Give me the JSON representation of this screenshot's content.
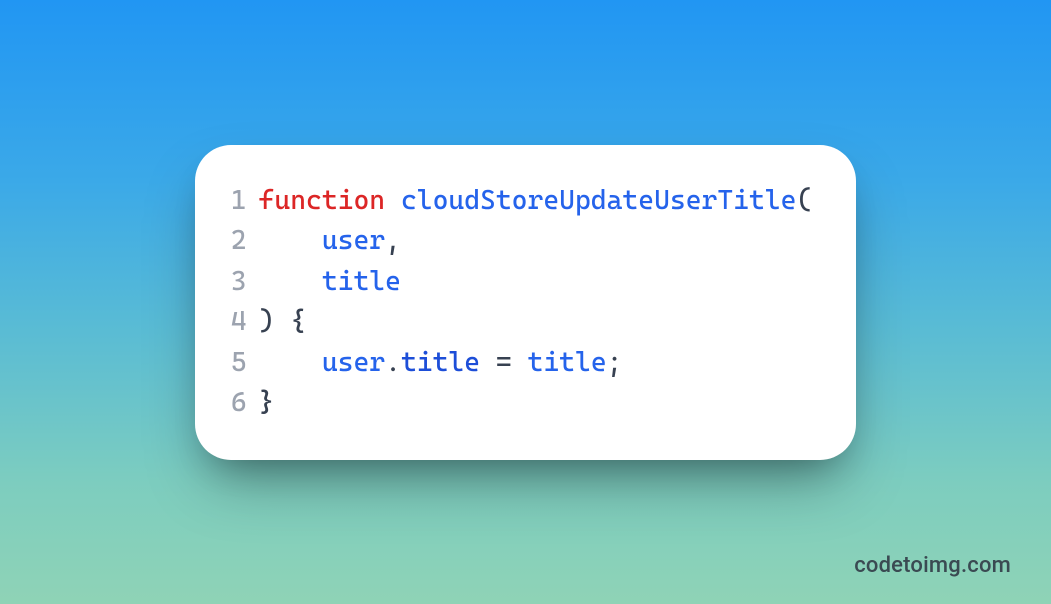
{
  "branding": "codetoimg.com",
  "code": {
    "language": "javascript",
    "lines": [
      {
        "number": "1",
        "tokens": [
          {
            "cls": "tok-keyword",
            "text": "function"
          },
          {
            "cls": "tok-plain",
            "text": " "
          },
          {
            "cls": "tok-func",
            "text": "cloudStoreUpdateUserTitle"
          },
          {
            "cls": "tok-punct",
            "text": "("
          }
        ]
      },
      {
        "number": "2",
        "tokens": [
          {
            "cls": "tok-plain",
            "text": "    "
          },
          {
            "cls": "tok-ident",
            "text": "user"
          },
          {
            "cls": "tok-punct",
            "text": ","
          }
        ]
      },
      {
        "number": "3",
        "tokens": [
          {
            "cls": "tok-plain",
            "text": "    "
          },
          {
            "cls": "tok-ident",
            "text": "title"
          }
        ]
      },
      {
        "number": "4",
        "tokens": [
          {
            "cls": "tok-punct",
            "text": ")"
          },
          {
            "cls": "tok-plain",
            "text": " "
          },
          {
            "cls": "tok-punct",
            "text": "{"
          }
        ]
      },
      {
        "number": "5",
        "tokens": [
          {
            "cls": "tok-plain",
            "text": "    "
          },
          {
            "cls": "tok-ident",
            "text": "user"
          },
          {
            "cls": "tok-punct",
            "text": "."
          },
          {
            "cls": "tok-prop",
            "text": "title"
          },
          {
            "cls": "tok-plain",
            "text": " "
          },
          {
            "cls": "tok-op",
            "text": "="
          },
          {
            "cls": "tok-plain",
            "text": " "
          },
          {
            "cls": "tok-ident",
            "text": "title"
          },
          {
            "cls": "tok-punct",
            "text": ";"
          }
        ]
      },
      {
        "number": "6",
        "tokens": [
          {
            "cls": "tok-punct",
            "text": "}"
          }
        ]
      }
    ]
  },
  "colors": {
    "keyword": "#dc2626",
    "identifier": "#2563eb",
    "punctuation": "#374151",
    "lineNumber": "#9ca3af",
    "cardBg": "#ffffff",
    "bgGradientStart": "#2196f3",
    "bgGradientEnd": "#8fd3b6"
  }
}
